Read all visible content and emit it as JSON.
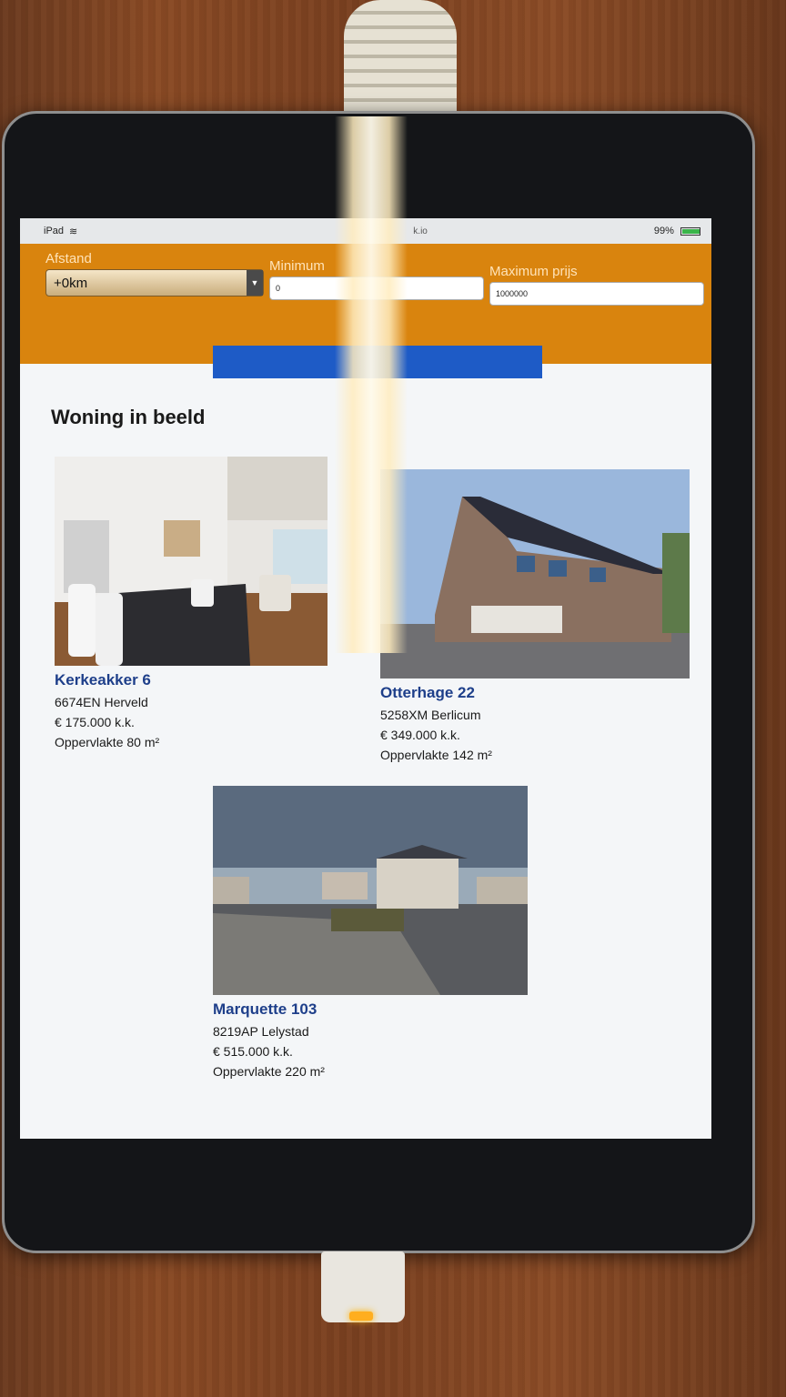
{
  "statusbar": {
    "device": "iPad",
    "url": "k.io",
    "battery": "99%"
  },
  "filters": {
    "distance_label": "Afstand",
    "distance_value": "+0km",
    "min_price_label": "Minimum",
    "min_price_value": "0",
    "max_price_label": "Maximum prijs",
    "max_price_value": "1000000"
  },
  "section": {
    "title": "Woning in beeld"
  },
  "listings": [
    {
      "name": "Kerkeakker 6",
      "postcode_city": "6674EN Herveld",
      "price": "€ 175.000 k.k.",
      "area": "Oppervlakte 80 m²"
    },
    {
      "name": "Otterhage 22",
      "postcode_city": "5258XM Berlicum",
      "price": "€ 349.000 k.k.",
      "area": "Oppervlakte 142 m²"
    },
    {
      "name": "Marquette 103",
      "postcode_city": "8219AP Lelystad",
      "price": "€ 515.000 k.k.",
      "area": "Oppervlakte 220 m²"
    }
  ],
  "colors": {
    "filter_bar": "#d9840e",
    "search_button": "#1e5bc6",
    "listing_title": "#1e3f8a"
  }
}
